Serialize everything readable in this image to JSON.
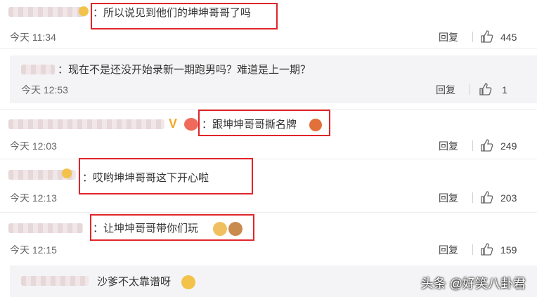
{
  "comments": [
    {
      "text": "：所以说见到他们的坤坤哥哥了吗",
      "time": "今天 11:34",
      "reply": "回复",
      "likes": "445"
    },
    {
      "text": "：现在不是还没开始录新一期跑男吗？难道是上一期？",
      "time": "今天 12:53",
      "reply": "回复",
      "likes": "1"
    },
    {
      "text": "：跟坤坤哥哥撕名牌",
      "time": "今天 12:03",
      "reply": "回复",
      "likes": "249"
    },
    {
      "text": "：哎哟坤坤哥哥这下开心啦",
      "time": "今天 12:13",
      "reply": "回复",
      "likes": "203"
    },
    {
      "text": "：让坤坤哥哥带你们玩",
      "time": "今天 12:15",
      "reply": "回复",
      "likes": "159"
    },
    {
      "text": "沙爹不太靠谱呀"
    }
  ],
  "watermark": "头条 @好笑八卦君",
  "colors": {
    "highlight": "#e0252a",
    "reply_bg": "#f4f4f6"
  }
}
